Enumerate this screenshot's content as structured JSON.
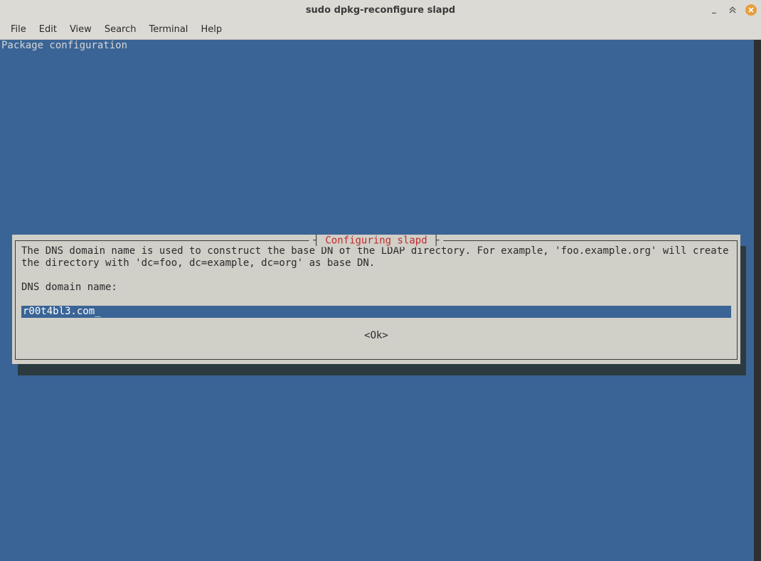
{
  "window": {
    "title": "sudo dpkg-reconfigure slapd"
  },
  "menu": {
    "items": [
      "File",
      "Edit",
      "View",
      "Search",
      "Terminal",
      "Help"
    ]
  },
  "terminal": {
    "header_line": "Package configuration"
  },
  "dialog": {
    "title": "Configuring slapd",
    "body_line1": "The DNS domain name is used to construct the base DN of the LDAP directory. For example, 'foo.example.org' will create the directory with 'dc=foo, dc=example, dc=org' as base DN.",
    "prompt": "DNS domain name:",
    "input_value": "r00t4bl3.com",
    "ok_label": "<Ok>"
  },
  "colors": {
    "terminal_bg": "#3a6495",
    "dialog_bg": "#d0cfc8",
    "dialog_title": "#c02c2c",
    "window_close": "#e59f3a"
  }
}
